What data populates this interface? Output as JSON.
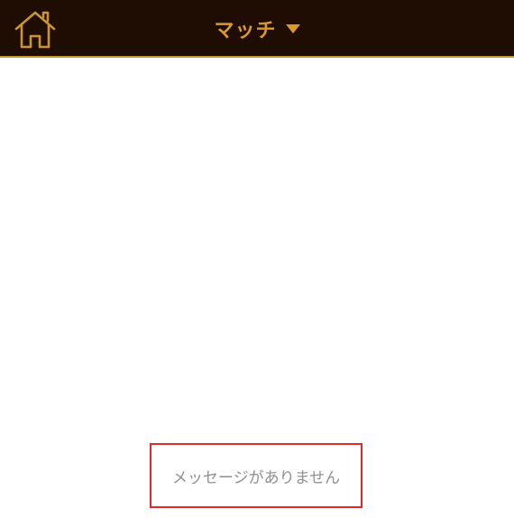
{
  "header": {
    "title": "マッチ",
    "home_icon": "home-icon",
    "dropdown_icon": "caret-down-icon",
    "background_color": "#1f0c02",
    "accent_color": "#d99a2b"
  },
  "main": {
    "empty_message": "メッセージがありません",
    "highlight_color": "#e12a28"
  }
}
